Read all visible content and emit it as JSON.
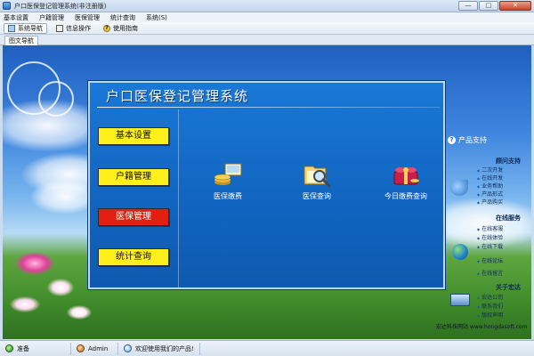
{
  "window": {
    "title": "户口医保登记管理系统(非注册版)",
    "minimize_glyph": "—",
    "maximize_glyph": "□",
    "close_glyph": "✕"
  },
  "menu": [
    "基本设置",
    "户籍管理",
    "医保管理",
    "统计查询",
    "系统(S)"
  ],
  "toolbar": [
    {
      "label": "系统导航",
      "icon": "monitor-icon",
      "active": true
    },
    {
      "label": "信息操作",
      "icon": "info-icon",
      "active": false
    },
    {
      "label": "使用指南",
      "icon": "help-icon",
      "active": false
    }
  ],
  "tab": {
    "label": "图文导航"
  },
  "panel": {
    "title": "户口医保登记管理系统",
    "nav": [
      {
        "label": "基本设置",
        "active": false
      },
      {
        "label": "户籍管理",
        "active": false
      },
      {
        "label": "医保管理",
        "active": true
      },
      {
        "label": "统计查询",
        "active": false
      }
    ],
    "functions": [
      {
        "label": "医保缴费",
        "icon": "payment-icon"
      },
      {
        "label": "医保查询",
        "icon": "search-icon"
      },
      {
        "label": "今日缴费查询",
        "icon": "gift-money-icon"
      }
    ]
  },
  "support": {
    "title": "产品支持",
    "sections": [
      {
        "title": "顾问支持",
        "items": [
          "二次开发",
          "在线开发",
          "业务帮助",
          "产品形式",
          "产品购买"
        ]
      },
      {
        "title": "在线服务",
        "items": [
          "在线客服",
          "在线体验",
          "在线下载",
          "在线论坛",
          "在线留言"
        ]
      },
      {
        "title": "关于宏达",
        "items": [
          "宏达公司",
          "联系我们",
          "版权声明"
        ]
      }
    ]
  },
  "bottom_link": "宏达科技网站 www.hongdasoft.com",
  "status": {
    "ready": "准备",
    "user": "Admin",
    "welcome": "欢迎使用我们的产品!"
  },
  "colors": {
    "panel_blue": "#1164bf",
    "nav_yellow": "#ffef1a",
    "nav_active_red": "#e21f10"
  }
}
